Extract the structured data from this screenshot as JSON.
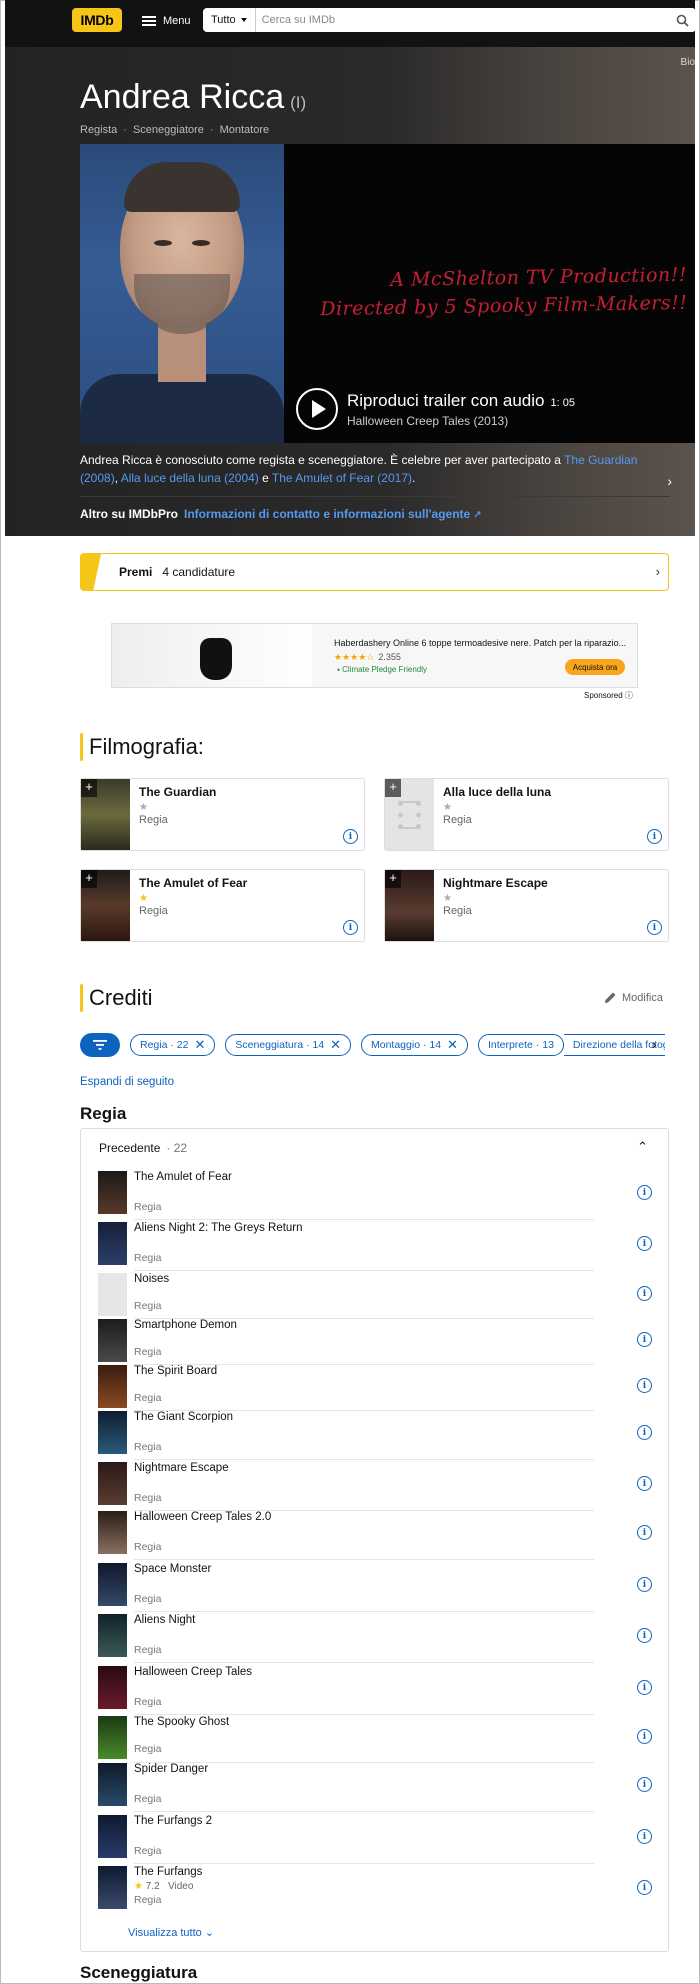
{
  "navbar": {
    "logo": "IMDb",
    "menu_label": "Menu",
    "search_category": "Tutto",
    "search_placeholder": "Cerca su IMDb"
  },
  "hero": {
    "top_link": "Bio",
    "name": "Andrea Ricca",
    "name_suffix": "(I)",
    "roles": [
      "Regista",
      "Sceneggiatore",
      "Montatore"
    ],
    "video_overlay_line1": "A McShelton TV Production!!",
    "video_overlay_line2": "Directed by 5 Spooky Film-Makers!!",
    "trailer_title": "Riproduci trailer con audio",
    "trailer_duration": "1: 05",
    "trailer_subtitle": "Halloween Creep Tales (2013)",
    "bio_prefix": "Andrea Ricca è conosciuto come regista e sceneggiatore. È celebre per aver partecipato a ",
    "bio_link1": "The Guardian (2008)",
    "bio_sep1": ", ",
    "bio_link2": "Alla luce della luna (2004)",
    "bio_sep2": " e ",
    "bio_link3": "The Amulet of Fear (2017)",
    "bio_suffix": ".",
    "pro_label": "Altro su IMDbPro",
    "pro_link": "Informazioni di contatto e informazioni sull'agente"
  },
  "awards": {
    "label": "Premi",
    "count": "4 candidature"
  },
  "ad": {
    "title": "Haberdashery Online 6 toppe termoadesive nere. Patch per la riparazio...",
    "stars": "★★★★☆",
    "rating_count": "2.355",
    "pledge": "Climate Pledge Friendly",
    "cta": "Acquista ora",
    "sponsored": "Sponsored"
  },
  "filmography": {
    "title": "Filmografia:",
    "cards": [
      {
        "title": "The Guardian",
        "role": "Regia"
      },
      {
        "title": "Alla luce della luna",
        "role": "Regia"
      },
      {
        "title": "The Amulet of Fear",
        "role": "Regia"
      },
      {
        "title": "Nightmare Escape",
        "role": "Regia"
      }
    ]
  },
  "credits": {
    "title": "Crediti",
    "edit_label": "Modifica",
    "chips": [
      "Regia · 22",
      "Sceneggiatura · 14",
      "Montaggio · 14",
      "Interprete · 13",
      "Direzione della fotografia"
    ],
    "expand_label": "Espandi di seguito",
    "regia_heading": "Regia",
    "panel_label": "Precedente",
    "panel_count": "· 22",
    "rows": [
      {
        "title": "The Amulet of Fear",
        "role": "Regia"
      },
      {
        "title": "Aliens Night 2: The Greys Return",
        "role": "Regia"
      },
      {
        "title": "Noises",
        "role": "Regia"
      },
      {
        "title": "Smartphone Demon",
        "role": "Regia"
      },
      {
        "title": "The Spirit Board",
        "role": "Regia"
      },
      {
        "title": "The Giant Scorpion",
        "role": "Regia"
      },
      {
        "title": "Nightmare Escape",
        "role": "Regia"
      },
      {
        "title": "Halloween Creep Tales 2.0",
        "role": "Regia"
      },
      {
        "title": "Space Monster",
        "role": "Regia"
      },
      {
        "title": "Aliens Night",
        "role": "Regia"
      },
      {
        "title": "Halloween Creep Tales",
        "role": "Regia"
      },
      {
        "title": "The Spooky Ghost",
        "role": "Regia"
      },
      {
        "title": "Spider Danger",
        "role": "Regia"
      },
      {
        "title": "The Furfangs 2",
        "role": "Regia"
      },
      {
        "title": "The Furfangs",
        "rating": "7.2",
        "kind": "Video",
        "role": "Regia"
      }
    ],
    "show_all": "Visualizza tutto",
    "next_heading": "Sceneggiatura"
  }
}
